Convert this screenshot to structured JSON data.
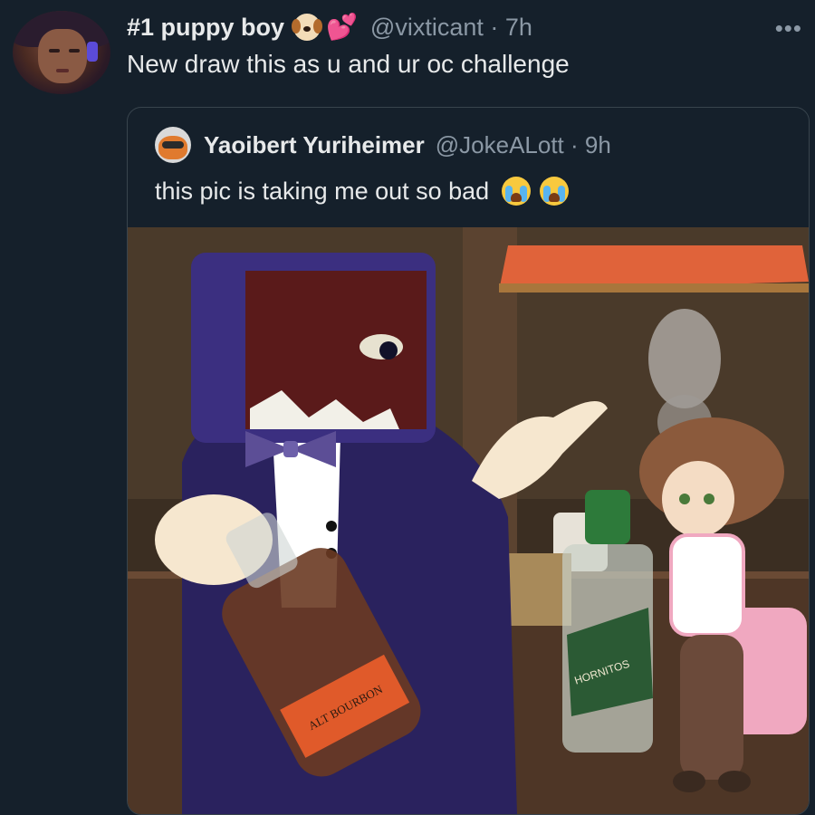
{
  "tweet": {
    "display_name": "#1 puppy boy",
    "name_emojis": [
      "dog-face-emoji",
      "two-hearts-emoji"
    ],
    "handle": "@vixticant",
    "time": "7h",
    "text": "New draw this as u and ur oc challenge",
    "more_icon": "more-horizontal-icon"
  },
  "quoted_tweet": {
    "display_name": "Yaoibert Yuriheimer",
    "handle": "@JokeALott",
    "time": "9h",
    "text": "this pic is taking me out so bad",
    "text_emojis": [
      "loudly-crying-face-emoji",
      "loudly-crying-face-emoji"
    ],
    "media": {
      "bottle_label_left": "ALT BOURBON",
      "bottle_label_right": "HORNITOS"
    }
  },
  "colors": {
    "background": "#15202b",
    "text_primary": "#e7e9ea",
    "text_secondary": "#8b98a5",
    "border": "#38444d"
  }
}
